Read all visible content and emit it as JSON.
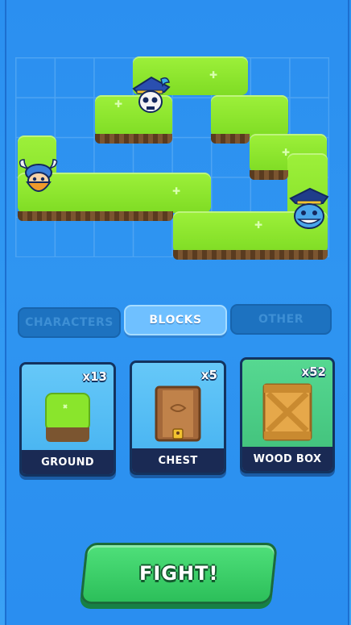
{
  "tabs": [
    {
      "label": "CHARACTERS",
      "active": false
    },
    {
      "label": "BLOCKS",
      "active": true
    },
    {
      "label": "OTHER",
      "active": false
    }
  ],
  "cards": [
    {
      "label": "GROUND",
      "count": "x13",
      "icon": "grass-block-icon",
      "bg": "#60c4f7"
    },
    {
      "label": "CHEST",
      "count": "x5",
      "icon": "chest-icon",
      "bg": "#60c4f7"
    },
    {
      "label": "WOOD BOX",
      "count": "x52",
      "icon": "wood-box-icon",
      "bg": "#4fcf86",
      "selected": true
    }
  ],
  "fight_label": "FIGHT!",
  "colors": {
    "water": "#2f95f1",
    "grass": "#8ae52c",
    "button": "#34c864",
    "card_label": "#1a2a54"
  }
}
